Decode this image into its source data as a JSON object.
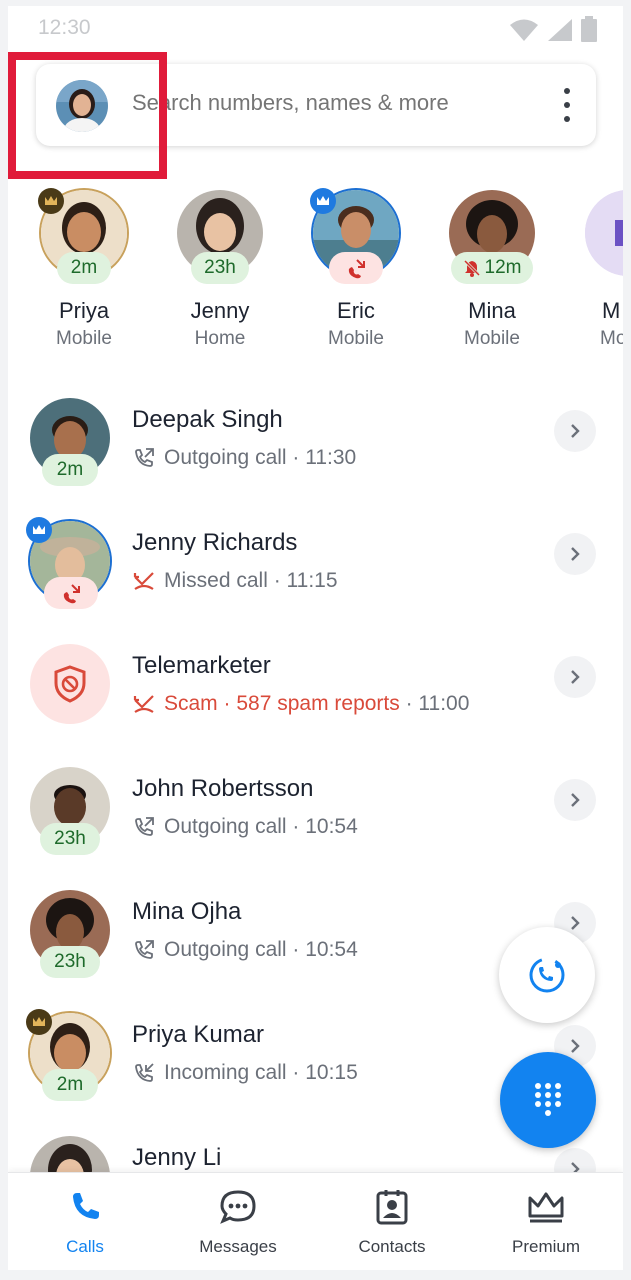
{
  "status_bar": {
    "time": "12:30"
  },
  "search": {
    "placeholder": "Search numbers, names & more"
  },
  "favorites": [
    {
      "name": "Priya",
      "type": "Mobile",
      "badge": "2m",
      "badge_style": "green",
      "crown": "gold"
    },
    {
      "name": "Jenny",
      "type": "Home",
      "badge": "23h",
      "badge_style": "green",
      "crown": ""
    },
    {
      "name": "Eric",
      "type": "Mobile",
      "badge": "",
      "badge_style": "red-missed",
      "crown": "blue"
    },
    {
      "name": "Mina",
      "type": "Mobile",
      "badge": "12m",
      "badge_style": "green-muted",
      "crown": ""
    },
    {
      "name": "M",
      "type": "Mo",
      "badge": "",
      "badge_style": "",
      "crown": ""
    }
  ],
  "calls": [
    {
      "name": "Deepak Singh",
      "direction_icon": "outgoing-call-icon",
      "detail": "Outgoing call · 11:30",
      "badge": "2m"
    },
    {
      "name": "Jenny Richards",
      "direction_icon": "missed-call-icon",
      "detail": "Missed call · 11:15",
      "badge": ""
    },
    {
      "name": "Telemarketer",
      "direction_icon": "missed-call-icon",
      "spam_text": "Scam · 587 spam reports",
      "detail_suffix": " · 11:00"
    },
    {
      "name": "John Robertsson",
      "direction_icon": "outgoing-call-icon",
      "detail": "Outgoing call · 10:54",
      "badge": "23h"
    },
    {
      "name": "Mina Ojha",
      "direction_icon": "outgoing-call-icon",
      "detail": "Outgoing call · 10:54",
      "badge": "23h"
    },
    {
      "name": "Priya Kumar",
      "direction_icon": "incoming-call-icon",
      "detail": "Incoming call · 10:15",
      "badge": "2m"
    },
    {
      "name": "Jenny Li",
      "direction_icon": "",
      "detail": "",
      "badge": ""
    }
  ],
  "nav": {
    "calls": "Calls",
    "messages": "Messages",
    "contacts": "Contacts",
    "premium": "Premium"
  },
  "colors": {
    "accent": "#1283f0",
    "missed": "#d94a3a",
    "badge_green_bg": "#dff2de",
    "highlight": "#e01b3a"
  }
}
